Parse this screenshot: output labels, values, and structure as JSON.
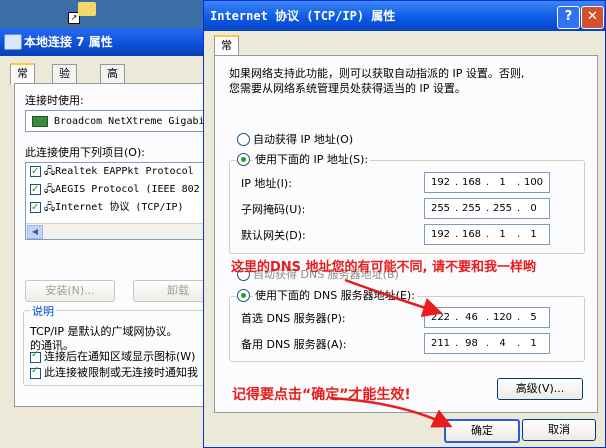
{
  "back_window": {
    "title": "本地连接 7 属性",
    "tabs": [
      "常规",
      "验证",
      "高级"
    ],
    "connect_using_label": "连接时使用:",
    "adapter": "Broadcom NetXtreme Gigabit",
    "items_label": "此连接使用下列项目(O):",
    "items": [
      {
        "label": "Realtek EAPPkt Protocol"
      },
      {
        "label": "AEGIS Protocol (IEEE 802"
      },
      {
        "label": "Internet 协议 (TCP/IP)"
      }
    ],
    "install_button": "安装(N)...",
    "uninstall_button": "卸载",
    "desc_group_label": "说明",
    "desc_text_1": "TCP/IP 是默认的广域网协议。",
    "desc_text_2": "的通讯。",
    "check_show_icon": "连接后在通知区域显示图标(W)",
    "check_notify": "此连接被限制或无连接时通知我"
  },
  "dialog": {
    "title": "Internet 协议 (TCP/IP) 属性",
    "help_glyph": "?",
    "close_glyph": "✕",
    "tab": "常规",
    "description_1": "如果网络支持此功能，则可以获取自动指派的 IP 设置。否则,",
    "description_2": "您需要从网络系统管理员处获得适当的 IP 设置。",
    "auto_ip_label": "自动获得 IP 地址(O)",
    "manual_ip_label": "使用下面的 IP 地址(S):",
    "ip_label": "IP 地址(I):",
    "ip": [
      "192",
      "168",
      "1",
      "100"
    ],
    "mask_label": "子网掩码(U):",
    "mask": [
      "255",
      "255",
      "255",
      "0"
    ],
    "gateway_label": "默认网关(D):",
    "gateway": [
      "192",
      "168",
      "1",
      "1"
    ],
    "auto_dns_label": "自动获得 DNS 服务器地址(B)",
    "manual_dns_label": "使用下面的 DNS 服务器地址(E):",
    "pref_dns_label": "首选 DNS 服务器(P):",
    "pref_dns": [
      "222",
      "46",
      "120",
      "5"
    ],
    "alt_dns_label": "备用 DNS 服务器(A):",
    "alt_dns": [
      "211",
      "98",
      "4",
      "1"
    ],
    "advanced_button": "高级(V)...",
    "ok_button": "确定",
    "cancel_button": "取消"
  },
  "annotations": {
    "dns_note": "这里的DNS 地址您的有可能不同, 请不要和我一样哟",
    "ok_note": "记得要点击“确定”才能生效!"
  },
  "colors": {
    "annotation": "#e81c1c",
    "selected_radio": "#21a121",
    "title_bar": "#0a5ce6"
  }
}
